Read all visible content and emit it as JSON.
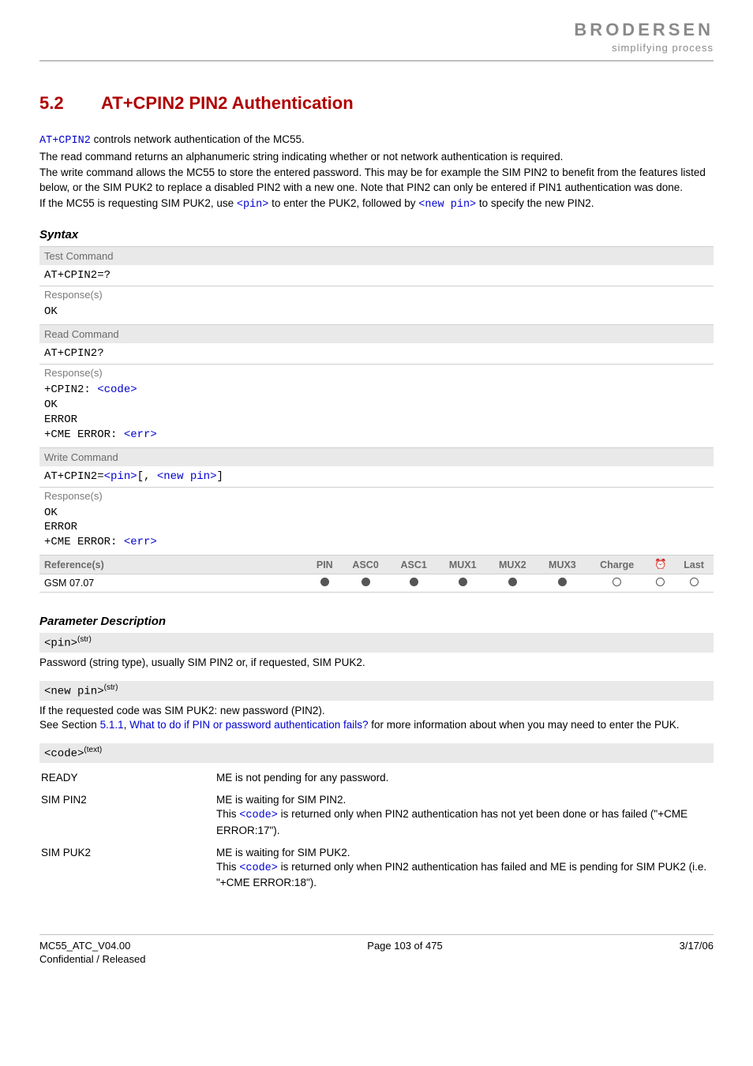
{
  "header": {
    "brand": "BRODERSEN",
    "tagline": "simplifying process"
  },
  "section": {
    "number": "5.2",
    "title": "AT+CPIN2   PIN2 Authentication"
  },
  "intro": {
    "cmd_name": "AT+CPIN2",
    "line1_rest": " controls network authentication of the MC55.",
    "line2": "The read command returns an alphanumeric string indicating whether or not network authentication is required.",
    "line3": "The write command allows the MC55 to store the entered password. This may be for example the SIM PIN2 to benefit from the features listed below, or the SIM PUK2 to replace a disabled PIN2 with a new one. Note that PIN2 can only be entered if PIN1 authentication was done.",
    "line4_pre": "If the MC55 is requesting SIM PUK2, use ",
    "pin_token": "<pin>",
    "line4_mid": " to enter the PUK2, followed by ",
    "newpin_token": "<new pin>",
    "line4_post": " to specify the new PIN2."
  },
  "syntax_label": "Syntax",
  "syntax": {
    "test": {
      "label": "Test Command",
      "cmd": "AT+CPIN2=?",
      "resp_label": "Response(s)",
      "resp": "OK"
    },
    "read": {
      "label": "Read Command",
      "cmd": "AT+CPIN2?",
      "resp_label": "Response(s)",
      "resp_l1_pre": "+CPIN2: ",
      "resp_l1_code": "<code>",
      "resp_l2": "OK",
      "resp_l3": "ERROR",
      "resp_l4_pre": "+CME ERROR: ",
      "resp_l4_err": "<err>"
    },
    "write": {
      "label": "Write Command",
      "cmd_pre": "AT+CPIN2=",
      "cmd_pin": "<pin>",
      "cmd_mid": "[, ",
      "cmd_newpin": "<new pin>",
      "cmd_post": "]",
      "resp_label": "Response(s)",
      "resp_l1": "OK",
      "resp_l2": "ERROR",
      "resp_l3_pre": "+CME ERROR: ",
      "resp_l3_err": "<err>"
    }
  },
  "refs": {
    "ref_label": "Reference(s)",
    "cols": [
      "PIN",
      "ASC0",
      "ASC1",
      "MUX1",
      "MUX2",
      "MUX3",
      "Charge",
      "⏰",
      "Last"
    ],
    "ref_value": "GSM 07.07",
    "support": [
      "filled",
      "filled",
      "filled",
      "filled",
      "filled",
      "filled",
      "empty",
      "empty",
      "empty"
    ]
  },
  "param_desc_label": "Parameter Description",
  "params": {
    "pin": {
      "token": "<pin>",
      "type": "(str)",
      "desc": "Password (string type), usually SIM PIN2 or, if requested, SIM PUK2."
    },
    "newpin": {
      "token": "<new pin>",
      "type": "(str)",
      "desc_l1": "If the requested code was SIM PUK2: new password (PIN2).",
      "desc_l2_pre": "See Section ",
      "sec_ref": "5.1.1",
      "sep": ", ",
      "link": "What to do if PIN or password authentication fails?",
      "desc_l2_post": " for more information about when you may need to enter the PUK."
    },
    "code": {
      "token": "<code>",
      "type": "(text)",
      "items": [
        {
          "k": "READY",
          "v": "ME is not pending for any password."
        },
        {
          "k": "SIM PIN2",
          "v_l1": "ME is waiting for SIM PIN2.",
          "v_l2_pre": "This ",
          "v_l2_code": "<code>",
          "v_l2_post": " is returned only when PIN2 authentication has not yet been done or has failed (\"+CME ERROR:17\")."
        },
        {
          "k": "SIM PUK2",
          "v_l1": "ME is waiting for SIM PUK2.",
          "v_l2_pre": "This ",
          "v_l2_code": "<code>",
          "v_l2_post": " is returned only when PIN2 authentication has failed and ME is pending for SIM PUK2 (i.e. \"+CME ERROR:18\")."
        }
      ]
    }
  },
  "footer": {
    "doc": "MC55_ATC_V04.00",
    "page": "Page 103 of 475",
    "date": "3/17/06",
    "conf": "Confidential / Released"
  }
}
